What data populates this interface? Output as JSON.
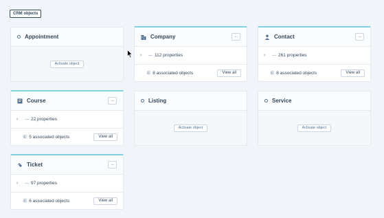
{
  "header": {
    "tag_label": "CRM objects"
  },
  "cards": {
    "appointment": {
      "title": "Appointment",
      "activate_label": "Activate object"
    },
    "company": {
      "title": "Company",
      "more_label": "···",
      "properties_count": "112 properties",
      "associated_label": "8 associated objects",
      "view_all_label": "View all",
      "icon": "building-icon"
    },
    "contact": {
      "title": "Contact",
      "more_label": "···",
      "properties_count": "261 properties",
      "associated_label": "8 associated objects",
      "view_all_label": "View all",
      "icon": "person-icon"
    },
    "course": {
      "title": "Course",
      "more_label": "···",
      "properties_count": "22 properties",
      "associated_label": "5 associated objects",
      "view_all_label": "View all",
      "icon": "book-icon"
    },
    "listing": {
      "title": "Listing",
      "activate_label": "Activate object"
    },
    "service": {
      "title": "Service",
      "activate_label": "Activate object"
    },
    "ticket": {
      "title": "Ticket",
      "more_label": "···",
      "properties_count": "97 properties",
      "associated_label": "6 associated objects",
      "view_all_label": "View all",
      "icon": "ticket-icon"
    }
  },
  "colors": {
    "accent_border": "#7fd1de",
    "text": "#33475b",
    "background": "#f1f4f8"
  }
}
